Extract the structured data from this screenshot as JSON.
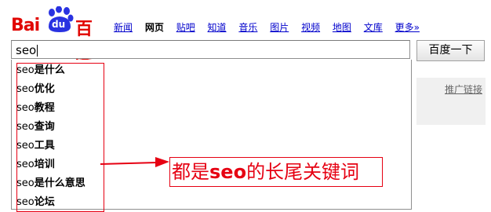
{
  "logo": {
    "text_left": "Bai",
    "text_middle": "du",
    "text_right": "百度"
  },
  "nav": [
    {
      "label": "新闻",
      "current": false
    },
    {
      "label": "网页",
      "current": true
    },
    {
      "label": "贴吧",
      "current": false
    },
    {
      "label": "知道",
      "current": false
    },
    {
      "label": "音乐",
      "current": false
    },
    {
      "label": "图片",
      "current": false
    },
    {
      "label": "视频",
      "current": false
    },
    {
      "label": "地图",
      "current": false
    },
    {
      "label": "文库",
      "current": false
    },
    {
      "label": "更多»",
      "current": false
    }
  ],
  "search": {
    "value": "seo",
    "button_label": "百度一下"
  },
  "suggestions": [
    {
      "query": "seo",
      "rest": "是什么"
    },
    {
      "query": "seo",
      "rest": "优化"
    },
    {
      "query": "seo",
      "rest": "教程"
    },
    {
      "query": "seo",
      "rest": "查询"
    },
    {
      "query": "seo",
      "rest": "工具"
    },
    {
      "query": "seo",
      "rest": "培训"
    },
    {
      "query": "seo",
      "rest": "是什么意思"
    },
    {
      "query": "seo",
      "rest": "论坛"
    }
  ],
  "ad": {
    "label": "推广链接"
  },
  "annotation": {
    "prefix": "都是",
    "keyword": "seo",
    "suffix": "的长尾关键词"
  },
  "colors": {
    "brand_red": "#e10602",
    "brand_blue": "#2932e1",
    "annotation_red": "#e60012",
    "link_blue": "#0000cc"
  }
}
